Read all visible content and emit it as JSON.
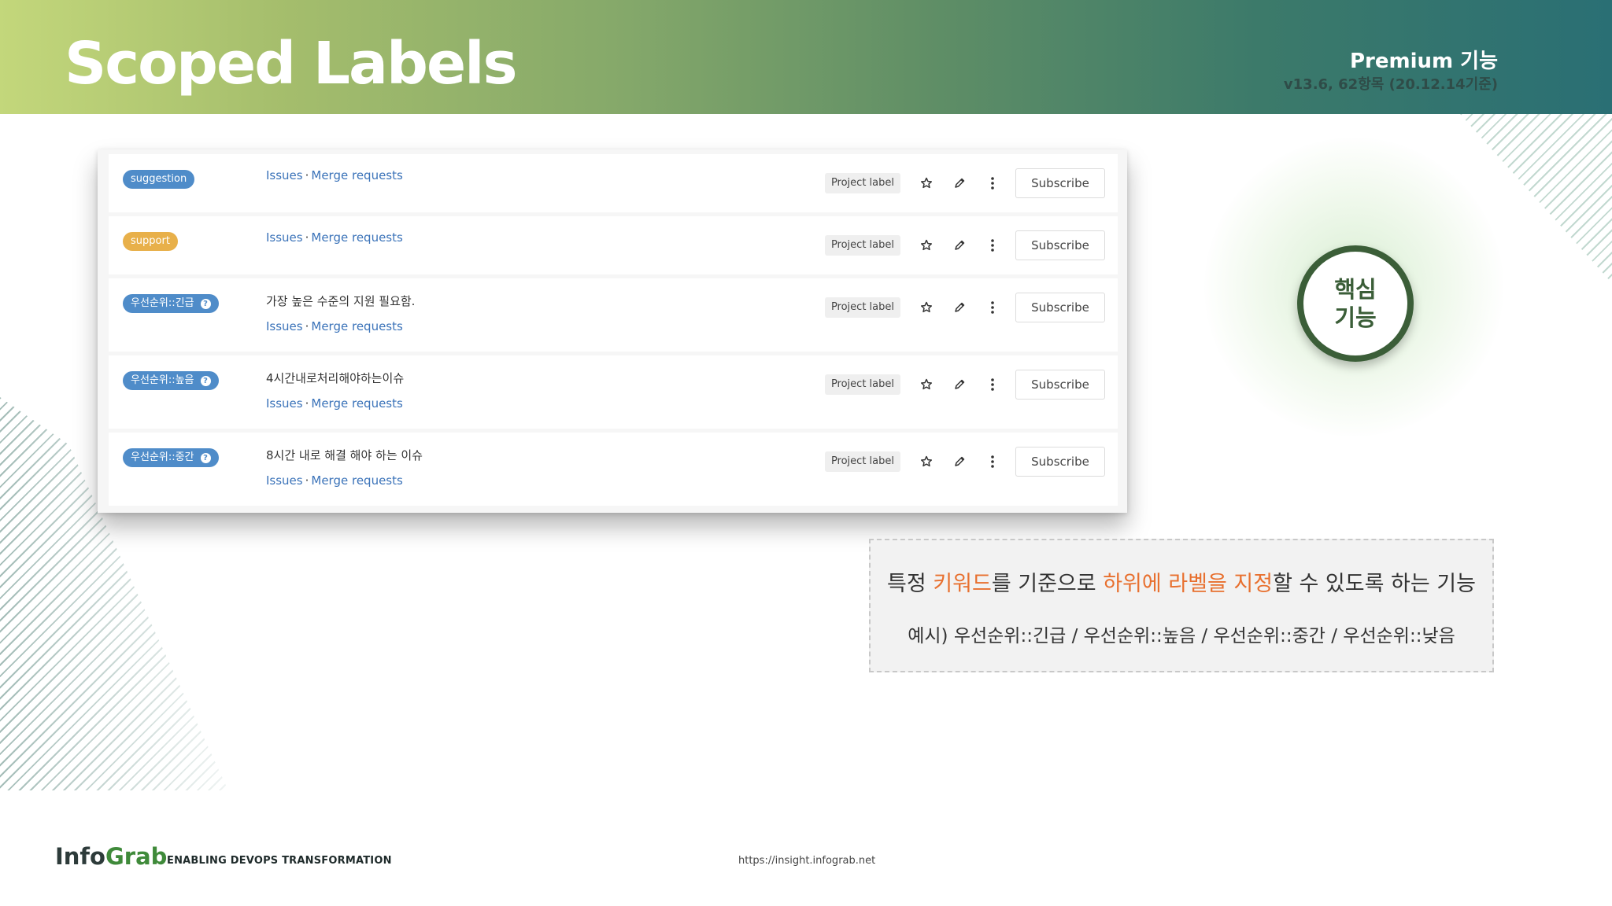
{
  "header": {
    "title": "Scoped Labels",
    "edition": "Premium 기능",
    "version": "v13.6, 62항목 (20.12.14기준)"
  },
  "colors": {
    "suggestion": "#4f8cc9",
    "support": "#e8b04a",
    "priority": "#4f8cc9",
    "highlight": "#e8702f",
    "core_badge": "#3b5e38"
  },
  "labels": [
    {
      "name": "suggestion",
      "scoped": false,
      "description": "",
      "issues": "Issues",
      "separator": "·",
      "merge_requests": "Merge requests",
      "type": "Project label",
      "subscribe": "Subscribe"
    },
    {
      "name": "support",
      "scoped": false,
      "description": "",
      "issues": "Issues",
      "separator": "·",
      "merge_requests": "Merge requests",
      "type": "Project label",
      "subscribe": "Subscribe"
    },
    {
      "name": "우선순위::긴급",
      "scoped": true,
      "description": "가장 높은 수준의 지원 필요함.",
      "issues": "Issues",
      "separator": "·",
      "merge_requests": "Merge requests",
      "type": "Project label",
      "subscribe": "Subscribe"
    },
    {
      "name": "우선순위::높음",
      "scoped": true,
      "description": "4시간내로처리해야하는이슈",
      "issues": "Issues",
      "separator": "·",
      "merge_requests": "Merge requests",
      "type": "Project label",
      "subscribe": "Subscribe"
    },
    {
      "name": "우선순위::중간",
      "scoped": true,
      "description": "8시간 내로 해결 해야 하는 이슈",
      "issues": "Issues",
      "separator": "·",
      "merge_requests": "Merge requests",
      "type": "Project label",
      "subscribe": "Subscribe"
    }
  ],
  "core_badge": {
    "line1": "핵심",
    "line2": "기능"
  },
  "explanation": {
    "part1": "특정 ",
    "keyword": "키워드",
    "part2": "를 기준으로 ",
    "phrase": "하위에 라벨을 지정",
    "part3": "할 수 있도록 하는 기능",
    "example": "예시) 우선순위::긴급  /  우선순위::높음  /  우선순위::중간  /  우선순위::낮음"
  },
  "footer": {
    "logo_info": "Info",
    "logo_grab": "Grab",
    "tagline": "ENABLING DEVOPS TRANSFORMATION",
    "url": "https://insight.infograb.net"
  }
}
